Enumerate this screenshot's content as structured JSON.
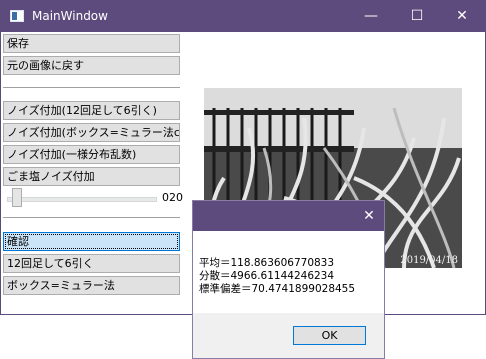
{
  "window": {
    "title": "MainWindow",
    "minimize_glyph": "—",
    "maximize_glyph": "☐",
    "close_glyph": "✕"
  },
  "buttons": {
    "save": "保存",
    "restore": "元の画像に戻す",
    "noise_add_12": "ノイズ付加(12回足して6引く)",
    "noise_add_box": "ノイズ付加(ボックス=ミュラー法cos)",
    "noise_add_uniform": "ノイズ付加(一様分布乱数)",
    "salt_pepper": "ごま塩ノイズ付加",
    "confirm": "確認",
    "add12_sub6": "12回足して6引く",
    "box_muller": "ボックス=ミュラー法"
  },
  "slider": {
    "value_text": "020",
    "value": 20
  },
  "image": {
    "date_stamp": "2019/04/18"
  },
  "dialog": {
    "close_glyph": "✕",
    "mean": "平均＝118.863606770833",
    "variance": "分散＝4966.61144246234",
    "stddev": "標準偏差＝70.4741899028455",
    "ok": "OK"
  },
  "colors": {
    "titlebar": "#5e4b7d",
    "focus_border": "#0078d7",
    "button_face": "#e1e1e1"
  }
}
